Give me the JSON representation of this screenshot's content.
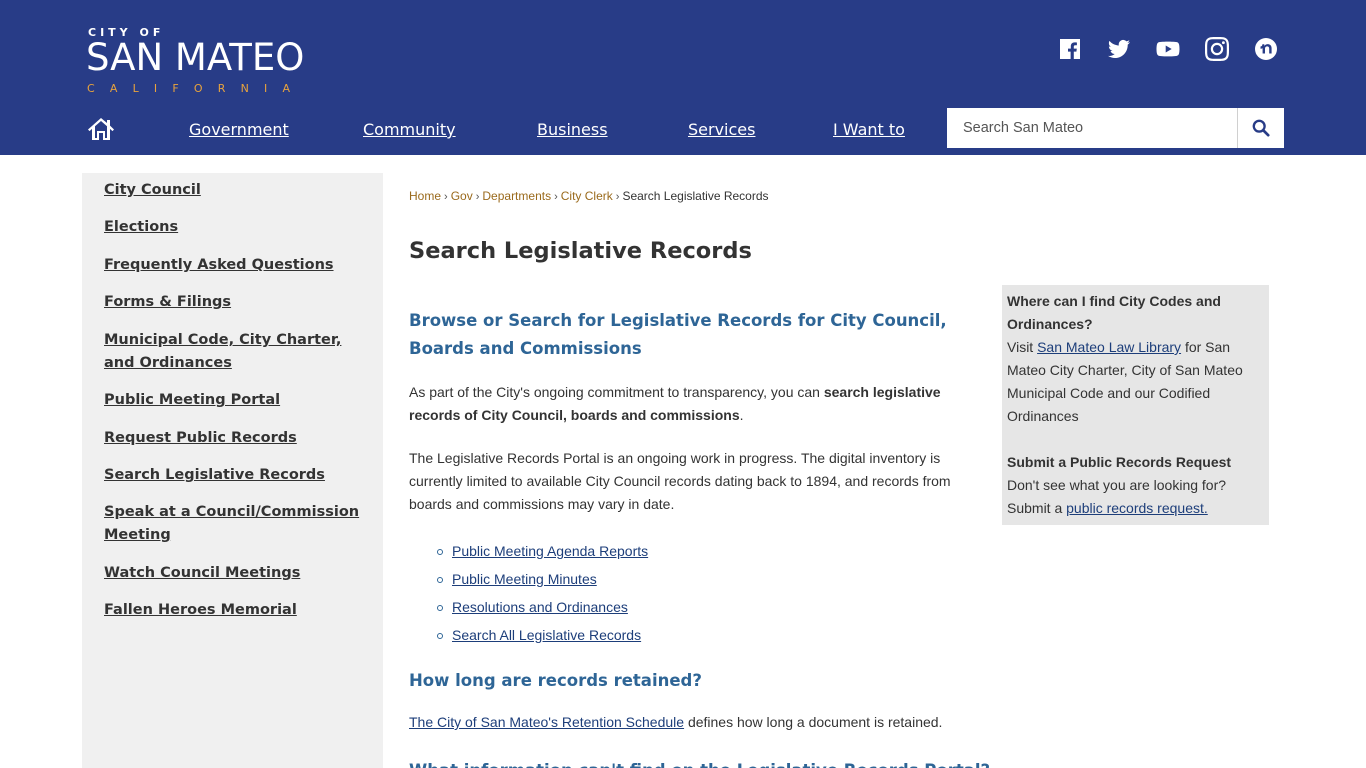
{
  "header": {
    "logo": {
      "city_of": "CITY OF",
      "name": "SAN MATEO",
      "state": "CALIFORNIA"
    },
    "social": [
      {
        "name": "facebook-icon",
        "label": "Facebook"
      },
      {
        "name": "twitter-icon",
        "label": "Twitter"
      },
      {
        "name": "youtube-icon",
        "label": "YouTube"
      },
      {
        "name": "instagram-icon",
        "label": "Instagram"
      },
      {
        "name": "nextdoor-icon",
        "label": "Nextdoor"
      }
    ],
    "nav": {
      "home_icon": "home-icon",
      "items": [
        "Government",
        "Community",
        "Business",
        "Services",
        "I Want to"
      ]
    },
    "search": {
      "placeholder": "Search San Mateo",
      "icon": "search-icon"
    }
  },
  "sidebar": {
    "items": [
      "City Council",
      "Elections",
      "Frequently Asked Questions",
      "Forms & Filings",
      "Municipal Code, City Charter, and Ordinances",
      "Public Meeting Portal",
      "Request Public Records",
      "Search Legislative Records",
      "Speak at a Council/Commission Meeting",
      "Watch Council Meetings",
      "Fallen Heroes Memorial"
    ]
  },
  "breadcrumb": {
    "links": [
      "Home",
      "Gov",
      "Departments",
      "City Clerk"
    ],
    "separator": "›",
    "current": "Search Legislative Records"
  },
  "main": {
    "title": "Search Legislative Records",
    "section1_heading": "Browse or Search for Legislative Records for City Council, Boards and Commissions",
    "para1_pre": "As part of the City's ongoing commitment to transparency, you can ",
    "para1_bold": "search legislative records of City Council, boards and commissions",
    "para1_post": ".",
    "para2": "The Legislative Records Portal is an ongoing work in progress. The digital inventory is currently limited to available City Council records dating back to 1894, and records from boards and commissions may vary in date.",
    "links": [
      "Public Meeting Agenda Reports",
      "Public Meeting Minutes",
      "Resolutions and Ordinances",
      "Search All Legislative Records"
    ],
    "section2_heading": "How long are records retained?",
    "retention_link": "The City of San Mateo's Retention Schedule",
    "retention_text": " defines how long a document is retained.",
    "section3_heading_partial": "What information can't find on the Legislative Records Portal?"
  },
  "infobox": {
    "q1_title": "Where can I find City Codes and Ordinances?",
    "q1_pre": "Visit ",
    "q1_link": "San Mateo Law Library",
    "q1_post": " for San Mateo City Charter, City of San Mateo Municipal Code and our Codified Ordinances",
    "q2_title": "Submit a Public Records Request",
    "q2_pre": "Don't see what you are looking for? Submit a ",
    "q2_link": "public records request."
  },
  "colors": {
    "header_bg": "#283c87",
    "logo_accent": "#e8a33d",
    "heading_blue": "#2e6596",
    "breadcrumb_link": "#9a6a1c",
    "sidebar_bg": "#f0f0f0",
    "infobox_bg": "#e6e6e6"
  }
}
